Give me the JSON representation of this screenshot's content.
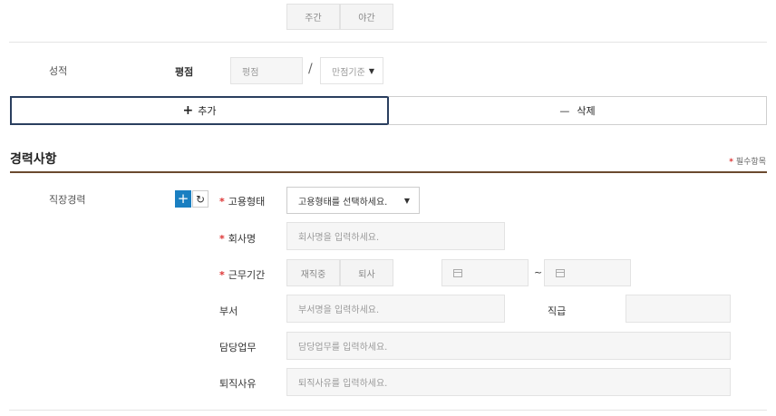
{
  "shift": {
    "day": "주간",
    "night": "야간"
  },
  "grades": {
    "section_label": "성적",
    "gpa_label": "평점",
    "gpa_placeholder": "평점",
    "slash": "/",
    "max_select": "만점기준",
    "add_label": "추가",
    "add_symbol": "+",
    "delete_label": "삭제",
    "delete_symbol": "—"
  },
  "career": {
    "title": "경력사항",
    "required_star": "*",
    "required_note": "필수항목",
    "section_label": "직장경력",
    "employment_type_label": "고용형태",
    "employment_type_select": "고용형태를 선택하세요.",
    "company_label": "회사명",
    "company_placeholder": "회사명을 입력하세요.",
    "period_label": "근무기간",
    "status_employed": "재직중",
    "status_resigned": "퇴사",
    "range_sep": "~",
    "dept_label": "부서",
    "dept_placeholder": "부서명을 입력하세요.",
    "position_label": "직급",
    "duty_label": "담당업무",
    "duty_placeholder": "담당업무를 입력하세요.",
    "reason_label": "퇴직사유",
    "reason_placeholder": "퇴직사유를 입력하세요."
  },
  "colors": {
    "accent_blue": "#1a7fc1",
    "title_rule": "#6b4a2e",
    "required_red": "#d33333"
  }
}
